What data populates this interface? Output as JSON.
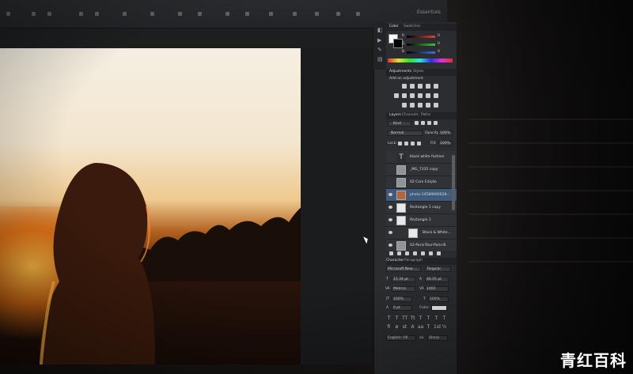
{
  "workspace": {
    "label": "Essentials"
  },
  "color_panel": {
    "tabs": [
      "Color",
      "Swatches"
    ],
    "channels": [
      {
        "name": "R",
        "value": "0",
        "color": "#e04040"
      },
      {
        "name": "G",
        "value": "0",
        "color": "#40c040"
      },
      {
        "name": "B",
        "value": "0",
        "color": "#4070e0"
      }
    ],
    "foreground": "#ffffff",
    "background": "#000000"
  },
  "adjustments_panel": {
    "tabs": [
      "Adjustments",
      "Styles"
    ],
    "heading": "Add an adjustment"
  },
  "layers_panel": {
    "tabs": [
      "Layers",
      "Channels",
      "Paths"
    ],
    "kind": "Kind",
    "blend_mode": "Normal",
    "opacity_label": "Opacity:",
    "opacity": "100%",
    "lock_label": "Lock:",
    "fill_label": "Fill:",
    "fill": "100%",
    "layers": [
      {
        "name": "black white fashion",
        "selected": false
      },
      {
        "name": "_MG_7335 copy",
        "selected": false
      },
      {
        "name": "02 Com Edição",
        "selected": false
      },
      {
        "name": "photo-14589690028-...",
        "selected": true
      },
      {
        "name": "Rectangle 1 copy",
        "selected": false
      },
      {
        "name": "Rectangle 1",
        "selected": false
      },
      {
        "name": "Black & White...",
        "selected": false
      },
      {
        "name": "02-Paris-Tour-Paris-B",
        "selected": false
      }
    ]
  },
  "character_panel": {
    "tabs": [
      "Character",
      "Paragraph"
    ],
    "font_family": "Microsoft New ...",
    "font_style": "Regular",
    "font_size": "15.34 pt",
    "leading": "46.05 pt",
    "kerning": "Metrics",
    "tracking": "1460",
    "vertical_scale": "100%",
    "horizontal_scale": "100%",
    "baseline_shift": "0 pt",
    "color_label": "Color:",
    "type_buttons": [
      "T",
      "T",
      "TT",
      "Tt",
      "T",
      "T",
      "T",
      "T"
    ],
    "opentype_buttons": [
      "fi",
      "ø",
      "st",
      "A",
      "aa",
      "T",
      "1st",
      "½"
    ],
    "language": "English: UK",
    "antialias": "Sharp"
  },
  "watermark": {
    "text": "青红百科"
  }
}
